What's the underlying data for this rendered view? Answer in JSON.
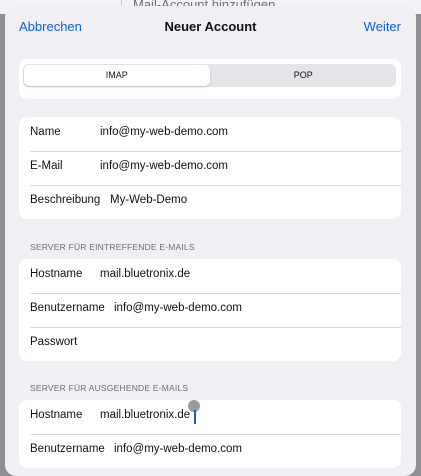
{
  "background": {
    "title": "Mail-Account hinzufügen"
  },
  "nav": {
    "cancel": "Abbrechen",
    "title": "Neuer Account",
    "next": "Weiter"
  },
  "protocol": {
    "options": [
      "IMAP",
      "POP"
    ],
    "selected": "IMAP"
  },
  "account": {
    "name_label": "Name",
    "name_value": "info@my-web-demo.com",
    "email_label": "E-Mail",
    "email_value": "info@my-web-demo.com",
    "desc_label": "Beschreibung",
    "desc_value": "My-Web-Demo"
  },
  "incoming": {
    "header": "SERVER FÜR EINTREFFENDE E-MAILS",
    "host_label": "Hostname",
    "host_value": "mail.bluetronix.de",
    "user_label": "Benutzername",
    "user_value": "info@my-web-demo.com",
    "pass_label": "Passwort",
    "pass_value": ""
  },
  "outgoing": {
    "header": "SERVER FÜR AUSGEHENDE E-MAILS",
    "host_label": "Hostname",
    "host_value": "mail.bluetronix.de",
    "user_label": "Benutzername",
    "user_value": "info@my-web-demo.com"
  },
  "colors": {
    "accent": "#0a62d6",
    "sheet_bg": "#efeff4",
    "card_bg": "#ffffff"
  }
}
